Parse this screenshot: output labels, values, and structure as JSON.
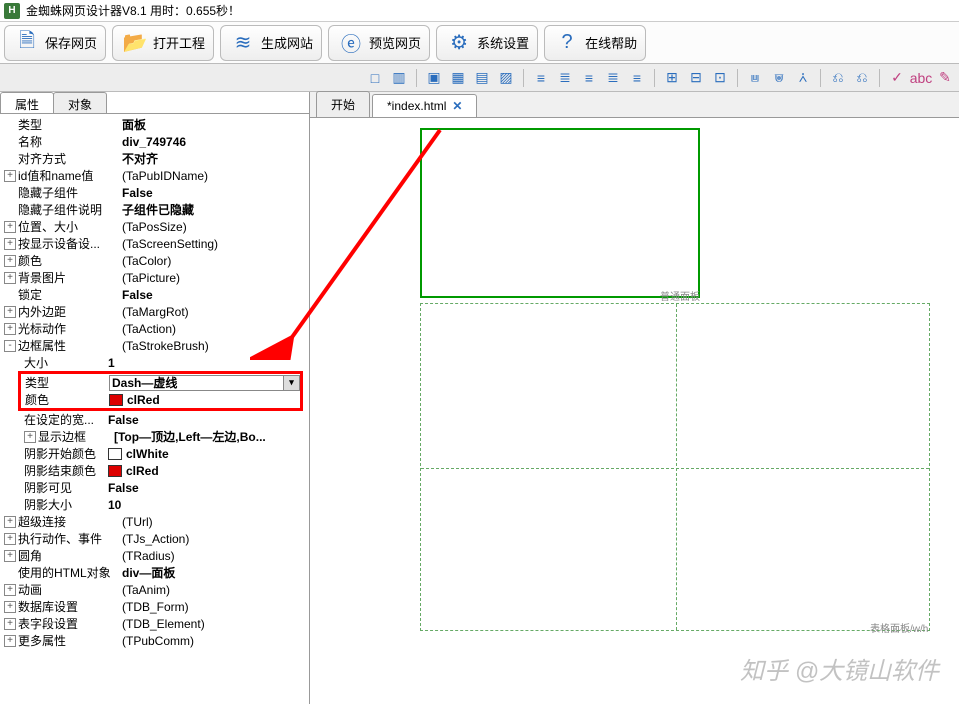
{
  "title": "金蜘蛛网页设计器V8.1  用时：0.655秒！",
  "app_icon_letter": "H",
  "main_toolbar": [
    {
      "icon": "🗎",
      "label": "保存网页"
    },
    {
      "icon": "📂",
      "label": "打开工程"
    },
    {
      "icon": "≋",
      "label": "生成网站"
    },
    {
      "icon": "ⓔ",
      "label": "预览网页"
    },
    {
      "icon": "⚙",
      "label": "系统设置"
    },
    {
      "icon": "?",
      "label": "在线帮助"
    }
  ],
  "sec_icons": [
    "□",
    "▥",
    "│",
    "▣",
    "▦",
    "▤",
    "▨",
    "│",
    "≡",
    "≣",
    "≡",
    "≣",
    "≡",
    "│",
    "⊞",
    "⊟",
    "⊡",
    "│",
    "⩏",
    "⩐",
    "⩑",
    "│",
    "⎌",
    "⎌",
    "│",
    "✓",
    "abc",
    "✎"
  ],
  "panel_tabs": {
    "attr": "属性",
    "obj": "对象"
  },
  "props": [
    {
      "exp": null,
      "name": "类型",
      "val": "面板",
      "bold": true
    },
    {
      "exp": null,
      "name": "名称",
      "val": "div_749746",
      "bold": true
    },
    {
      "exp": null,
      "name": "对齐方式",
      "val": "不对齐",
      "bold": true
    },
    {
      "exp": "+",
      "name": "id值和name值",
      "val": "(TaPubIDName)",
      "bold": false
    },
    {
      "exp": null,
      "name": "隐藏子组件",
      "val": "False",
      "bold": true
    },
    {
      "exp": null,
      "name": "隐藏子组件说明",
      "val": "子组件已隐藏",
      "bold": true
    },
    {
      "exp": "+",
      "name": "位置、大小",
      "val": "(TaPosSize)",
      "bold": false
    },
    {
      "exp": "+",
      "name": "按显示设备设...",
      "val": "(TaScreenSetting)",
      "bold": false
    },
    {
      "exp": "+",
      "name": "颜色",
      "val": "(TaColor)",
      "bold": false
    },
    {
      "exp": "+",
      "name": "背景图片",
      "val": "(TaPicture)",
      "bold": false
    },
    {
      "exp": null,
      "name": "锁定",
      "val": "False",
      "bold": true
    },
    {
      "exp": "+",
      "name": "内外边距",
      "val": "(TaMargRot)",
      "bold": false
    },
    {
      "exp": "+",
      "name": "光标动作",
      "val": "(TaAction)",
      "bold": false
    },
    {
      "exp": "-",
      "name": "边框属性",
      "val": "(TaStrokeBrush)",
      "bold": false
    }
  ],
  "border_sub": {
    "size_name": "大小",
    "size_val": "1",
    "type_name": "类型",
    "type_val": "Dash—虚线",
    "color_name": "颜色",
    "color_val": "clRed",
    "preset_name": "在设定的宽...",
    "preset_val": "False",
    "show_name": "显示边框",
    "show_val": "[Top—顶边,Left—左边,Bo...",
    "sstart_name": "阴影开始颜色",
    "sstart_val": "clWhite",
    "send_name": "阴影结束颜色",
    "send_val": "clRed",
    "svis_name": "阴影可见",
    "svis_val": "False",
    "ssize_name": "阴影大小",
    "ssize_val": "10"
  },
  "props_after": [
    {
      "exp": "+",
      "name": "超级连接",
      "val": "(TUrl)",
      "bold": false
    },
    {
      "exp": "+",
      "name": "执行动作、事件",
      "val": "(TJs_Action)",
      "bold": false
    },
    {
      "exp": "+",
      "name": "圆角",
      "val": "(TRadius)",
      "bold": false
    },
    {
      "exp": null,
      "name": "使用的HTML对象",
      "val": "div—面板",
      "bold": true
    },
    {
      "exp": "+",
      "name": "动画",
      "val": "(TaAnim)",
      "bold": false
    },
    {
      "exp": "+",
      "name": "数据库设置",
      "val": "(TDB_Form)",
      "bold": false
    },
    {
      "exp": "+",
      "name": "表字段设置",
      "val": "(TDB_Element)",
      "bold": false
    },
    {
      "exp": "+",
      "name": "更多属性",
      "val": "(TPubComm)",
      "bold": false
    }
  ],
  "doc_tabs": {
    "start": "开始",
    "file": "*index.html"
  },
  "canvas_labels": {
    "panel": "普通面板",
    "grid": "表格面板/w/h"
  },
  "watermark": "知乎 @大镜山软件"
}
